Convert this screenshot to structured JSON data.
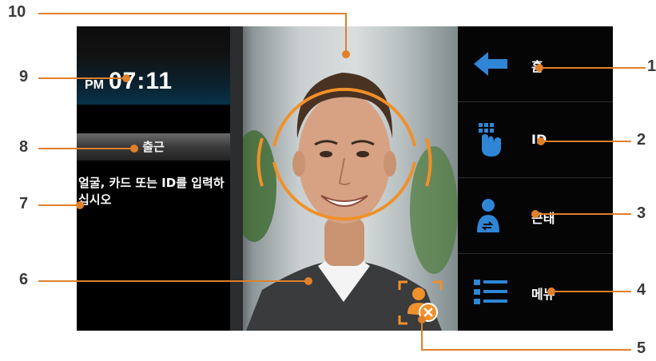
{
  "status": {
    "ampm": "PM",
    "time": "07:11",
    "mode_label": "출근",
    "message": "얼굴, 카드 또는 ID를 입력하십시오"
  },
  "menu": [
    {
      "label": "홈",
      "icon": "arrow-left-icon"
    },
    {
      "label": "ID",
      "icon": "keypad-touch-icon"
    },
    {
      "label": "근태",
      "icon": "attendance-person-icon"
    },
    {
      "label": "메뉴",
      "icon": "list-menu-icon"
    }
  ],
  "callouts": [
    "1",
    "2",
    "3",
    "4",
    "5",
    "6",
    "7",
    "8",
    "9",
    "10"
  ],
  "colors": {
    "accent_orange": "#f0902a",
    "icon_blue": "#2f86d6",
    "callout_line": "#e0802a"
  }
}
